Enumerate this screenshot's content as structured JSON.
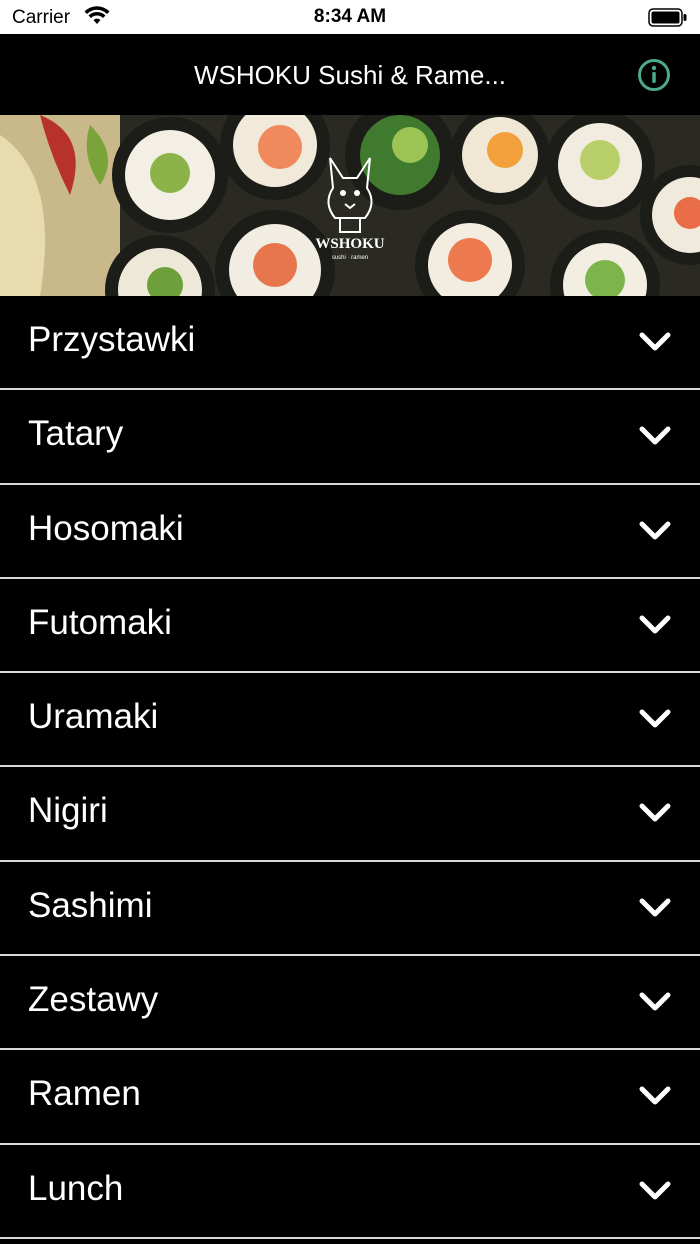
{
  "status_bar": {
    "carrier": "Carrier",
    "time": "8:34 AM"
  },
  "nav": {
    "title": "WSHOKU Sushi & Rame...",
    "info_icon": "info-circle-icon",
    "accent_color": "#4fa88c"
  },
  "banner": {
    "brand": "WSHOKU",
    "tagline": "sushi · ramen"
  },
  "menu": {
    "items": [
      {
        "label": "Przystawki"
      },
      {
        "label": "Tatary"
      },
      {
        "label": "Hosomaki"
      },
      {
        "label": "Futomaki"
      },
      {
        "label": "Uramaki"
      },
      {
        "label": "Nigiri"
      },
      {
        "label": "Sashimi"
      },
      {
        "label": "Zestawy"
      },
      {
        "label": "Ramen"
      },
      {
        "label": "Lunch"
      }
    ],
    "chevron_icon": "chevron-down-icon"
  }
}
